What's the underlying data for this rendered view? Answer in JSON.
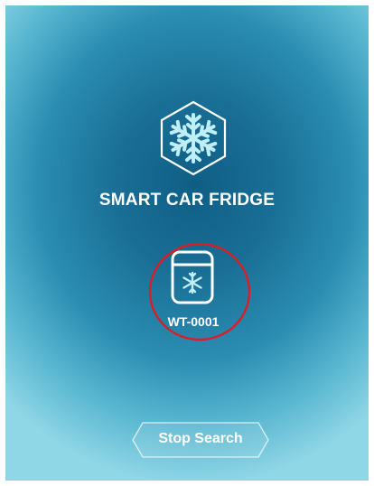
{
  "app": {
    "title": "SMART CAR FRIDGE",
    "logo_icon": "snowflake-hexagon-icon"
  },
  "devices": [
    {
      "id_label": "WT-0001",
      "icon": "fridge-snowflake-icon",
      "highlighted": true
    }
  ],
  "actions": {
    "stop_search_label": "Stop Search"
  },
  "colors": {
    "background_center": "#0f5e86",
    "background_edge": "#8fd6e6",
    "icon_light": "#bfeef7",
    "highlight_ring": "#d81f26",
    "text": "#ffffff"
  }
}
